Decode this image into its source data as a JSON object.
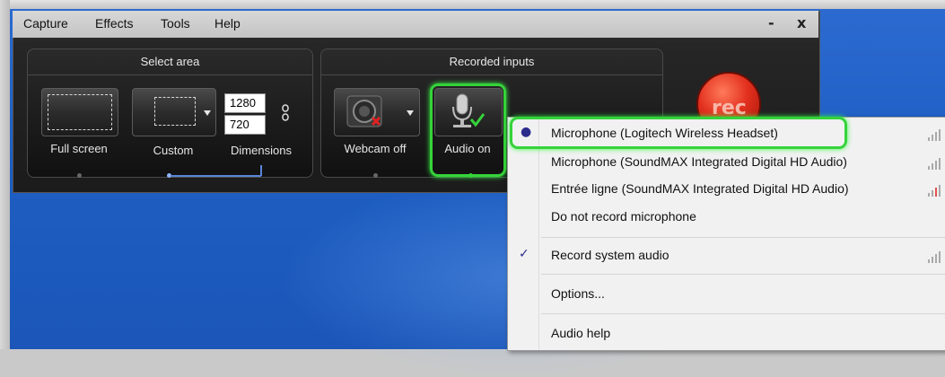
{
  "menubar": {
    "items": [
      "Capture",
      "Effects",
      "Tools",
      "Help"
    ],
    "minimize": "-",
    "close": "x"
  },
  "select_area": {
    "title": "Select area",
    "full_screen_label": "Full screen",
    "custom_label": "Custom",
    "width_value": "1280",
    "height_value": "720",
    "dimensions_label": "Dimensions"
  },
  "recorded_inputs": {
    "title": "Recorded inputs",
    "webcam_label": "Webcam off",
    "audio_label": "Audio on"
  },
  "rec_button": {
    "label": "rec"
  },
  "audio_menu": {
    "items": [
      "Microphone (Logitech Wireless Headset)",
      "Microphone (SoundMAX Integrated Digital HD Audio)",
      "Entrée ligne (SoundMAX Integrated Digital HD Audio)",
      "Do not record microphone",
      "Record system audio",
      "Options...",
      "Audio help"
    ],
    "selected_index": 0,
    "record_system_audio_checked": true
  },
  "colors": {
    "highlight": "#35d33a",
    "rec": "#e2301e",
    "desktop": "#1f5fc4"
  },
  "icons": [
    "link-icon",
    "webcam-icon",
    "microphone-icon",
    "checkmark-icon",
    "radio-dot-icon",
    "signal-bars-icon"
  ]
}
